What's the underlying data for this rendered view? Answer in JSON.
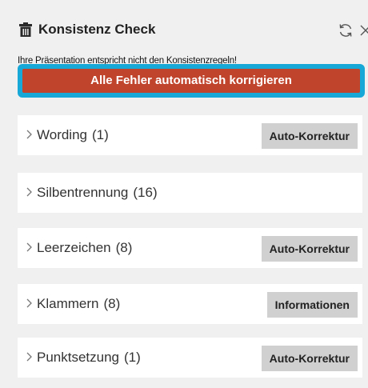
{
  "header": {
    "title": "Konsistenz Check",
    "subtitle": "Ihre Präsentation entspricht nicht den Konsistenzregeln!",
    "fix_all_label": "Alle Fehler automatisch korrigieren"
  },
  "icons": {
    "title_icon": "trash-icon",
    "refresh": "refresh-icon",
    "close": "close-icon",
    "chevron": "chevron-right-icon"
  },
  "colors": {
    "fix_all_button": "#c0432b",
    "focus_ring": "#18a8d8",
    "action_button": "#d0d0d0"
  },
  "categories": [
    {
      "label": "Wording",
      "count": "(1)",
      "action": "Auto-Korrektur"
    },
    {
      "label": "Silbentrennung",
      "count": "(16)",
      "action": ""
    },
    {
      "label": "Leerzeichen",
      "count": "(8)",
      "action": "Auto-Korrektur"
    },
    {
      "label": "Klammern",
      "count": "(8)",
      "action": "Informationen"
    },
    {
      "label": "Punktsetzung",
      "count": "(1)",
      "action": "Auto-Korrektur"
    }
  ]
}
